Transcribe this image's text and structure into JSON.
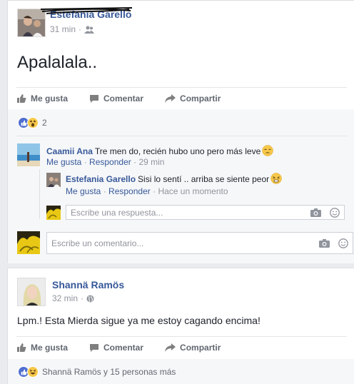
{
  "post1": {
    "author": "Estefania Garello",
    "time": "31 min",
    "audience_icon": "friends-icon",
    "text": "Apalalala..",
    "actions": {
      "like": "Me gusta",
      "comment": "Comentar",
      "share": "Compartir"
    },
    "reactions": {
      "icons": [
        "like-reaction-icon",
        "wow-reaction-icon"
      ],
      "count": "2"
    },
    "comment": {
      "author": "Caamii Ana",
      "text": "Tre men do, recién hubo uno pero más leve",
      "emoji": "pensive-face-emoji",
      "like": "Me gusta",
      "reply": "Responder",
      "time": "29 min"
    },
    "reply": {
      "author": "Estefania Garello",
      "text": "Sisi lo sentí .. arriba se siente peor",
      "emoji": "tired-face-emoji",
      "like": "Me gusta",
      "reply": "Responder",
      "time": "Hace un momento"
    },
    "reply_input_placeholder": "Escribe una respuesta...",
    "comment_input_placeholder": "Escribe un comentario..."
  },
  "post2": {
    "author": "Shannä Ramös",
    "time": "32 min",
    "audience_icon": "globe-icon",
    "text": "Lpm.! Esta Mierda sigue ya me estoy cagando encima!",
    "actions": {
      "like": "Me gusta",
      "comment": "Comentar",
      "share": "Compartir"
    },
    "reactions": {
      "icons": [
        "like-reaction-icon",
        "haha-reaction-icon"
      ],
      "text": "Shannä Ramös y 15 personas más"
    }
  },
  "colors": {
    "link": "#365899",
    "meta": "#90949c",
    "like_blue": "#4f6fd0",
    "bg": "#e9ebee"
  },
  "separator": "·"
}
